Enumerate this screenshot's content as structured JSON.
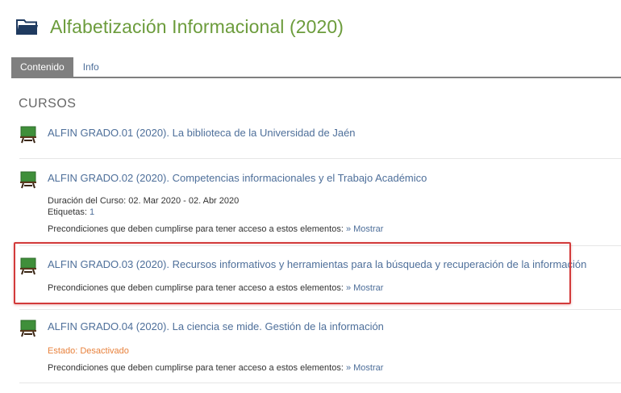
{
  "header": {
    "icon": "folder-icon",
    "title": "Alfabetización Informacional (2020)",
    "title_color": "#6c9c3c"
  },
  "tabs": [
    {
      "label": "Contenido",
      "active": true
    },
    {
      "label": "Info",
      "active": false
    }
  ],
  "section": {
    "title": "CURSOS"
  },
  "courses": [
    {
      "icon": "blackboard-icon",
      "title": "ALFIN GRADO.01 (2020). La biblioteca de la Universidad de Jaén"
    },
    {
      "icon": "blackboard-icon",
      "title": "ALFIN GRADO.02 (2020). Competencias informacionales y el Trabajo Académico",
      "duration": "Duración del Curso: 02. Mar 2020 - 02. Abr 2020",
      "tags_label": "Etiquetas:",
      "tags_value": "1",
      "preconditions": "Precondiciones que deben cumplirse para tener acceso a estos elementos:",
      "show_link": "» Mostrar"
    },
    {
      "icon": "blackboard-icon",
      "title": "ALFIN GRADO.03 (2020). Recursos informativos y herramientas para la búsqueda y recuperación de la información",
      "preconditions": "Precondiciones que deben cumplirse para tener acceso a estos elementos:",
      "show_link": "» Mostrar",
      "highlighted": true
    },
    {
      "icon": "blackboard-icon",
      "title": "ALFIN GRADO.04 (2020). La ciencia se mide. Gestión de la información",
      "status": "Estado: Desactivado",
      "preconditions": "Precondiciones que deben cumplirse para tener acceso a estos elementos:",
      "show_link": "» Mostrar"
    }
  ],
  "colors": {
    "link": "#4e6f9a",
    "status": "#e8823d",
    "highlight": "#d23a3a",
    "tab_active_bg": "#7f7f7f"
  }
}
